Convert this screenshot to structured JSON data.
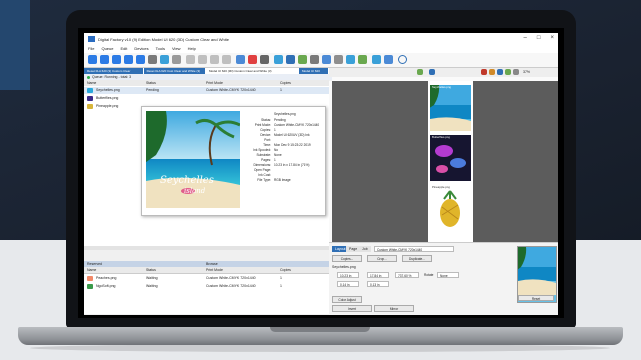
{
  "window": {
    "title": "Digital Factory v10 (9) Edition Model UI 620 (3D) Custom Clear and White",
    "controls": [
      "–",
      "□",
      "×"
    ]
  },
  "menu": [
    "File",
    "Queue",
    "Edit",
    "Devices",
    "Tools",
    "View",
    "Help"
  ],
  "tabs": [
    "Reset 0LA 620 (3) Custom Clear",
    "Reset 0LA 620 Cust Clear and White (3)",
    "Model UI 620 (3D) Custom Clear and White (3)",
    "Model UI 620"
  ],
  "queue_status": "Queue: Running - total: 3",
  "active_list": {
    "columns": [
      "Name",
      "Status",
      "Print Mode",
      "Copies"
    ],
    "rows": [
      {
        "name": "Seychelles.png",
        "status": "Pending",
        "mode": "Custom White-CMYK 720x1440",
        "copies": "1"
      },
      {
        "name": "Butterflies.png",
        "status": "",
        "mode": "",
        "copies": ""
      },
      {
        "name": "Pineapple.png",
        "status": "",
        "mode": "",
        "copies": ""
      }
    ]
  },
  "popup": {
    "filename": "Seychelles.png",
    "image_caption_1": "Seychelles",
    "image_caption_2": "island",
    "fields": [
      {
        "k": "Status:",
        "v": "Pending"
      },
      {
        "k": "Print Mode:",
        "v": "Custom White-CMYK 720x1440"
      },
      {
        "k": "Copies:",
        "v": "1"
      },
      {
        "k": "Device:",
        "v": "Model UI 620UV (3D) Ink"
      },
      {
        "k": "Port:",
        "v": ""
      },
      {
        "k": "Time:",
        "v": "Mon Dec 9 15:23:22 2019"
      },
      {
        "k": "Ink Spooled:",
        "v": "No"
      },
      {
        "k": "Substrate:",
        "v": "None"
      },
      {
        "k": "Pages:",
        "v": "1"
      },
      {
        "k": "Dimensions:",
        "v": "10.23 in x 17.84 in (71%)"
      },
      {
        "k": "Open Page:",
        "v": ""
      },
      {
        "k": "Ink Cost:",
        "v": ""
      },
      {
        "k": "File Type:",
        "v": "RGB Image"
      }
    ]
  },
  "lower": {
    "left_label": "Reserved",
    "right_label": "Browse",
    "columns": [
      "Name",
      "Status",
      "Print Mode",
      "Copies"
    ],
    "rows": [
      {
        "name": "Peaches.png",
        "status": "Waiting",
        "mode": "Custom White-CMYK 720x1440",
        "copies": "1"
      },
      {
        "name": "NgoSoft.png",
        "status": "Waiting",
        "mode": "Custom White-CMYK 720x1440",
        "copies": "1"
      }
    ]
  },
  "right": {
    "zoom": "37%",
    "layout_items": [
      "Seychelles.png",
      "Butterflies.png",
      "Pineapple.png"
    ],
    "panel_tabs": [
      "Layout",
      "Page",
      "Job"
    ],
    "print_mode_value": "Custom White-CMYK 720x1440",
    "buttons": [
      "Copies...",
      "Crop...",
      "Duplicate..."
    ],
    "selected_file": "Seychelles.png",
    "x_value": "10.23 in",
    "y_value": "17.84 in",
    "scale_value": "737.60 %",
    "w_value": "0.14 in",
    "h_value": "0.13 in",
    "rotate_label": "Rotate",
    "rotate_value": "None",
    "color_adjust_label": "Color Adjust",
    "invert_label": "Invert",
    "mirror_label": "Mirror",
    "reset_label": "Reset"
  },
  "colors": {
    "accent": "#2f6fb5",
    "canvas": "#5c5c5c",
    "ocean": "#1aa3d8"
  }
}
